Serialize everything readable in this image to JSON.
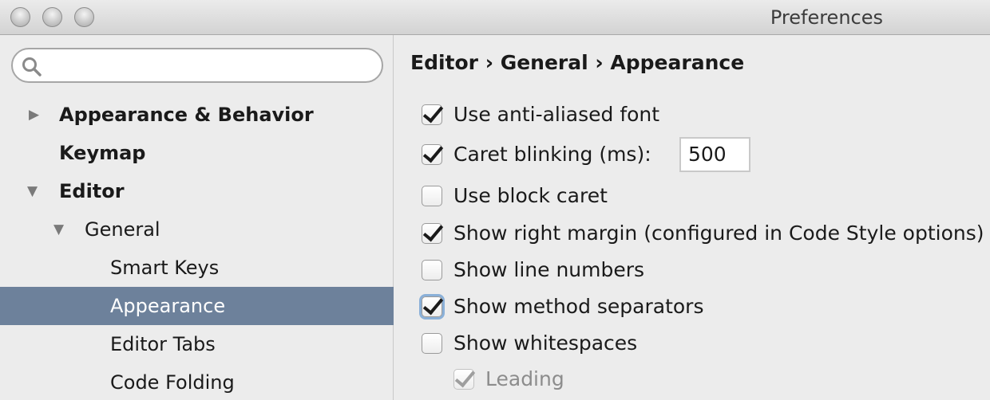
{
  "window": {
    "title": "Preferences"
  },
  "search": {
    "placeholder": "",
    "value": ""
  },
  "sidebar": {
    "items": [
      {
        "label": "Appearance & Behavior",
        "arrow": "▶"
      },
      {
        "label": "Keymap"
      },
      {
        "label": "Editor",
        "arrow": "▼"
      },
      {
        "label": "General",
        "arrow": "▼"
      },
      {
        "label": "Smart Keys"
      },
      {
        "label": "Appearance"
      },
      {
        "label": "Editor Tabs"
      },
      {
        "label": "Code Folding"
      }
    ],
    "selected": "Appearance"
  },
  "main": {
    "breadcrumb": "Editor › General › Appearance",
    "caret_blink_value": "500",
    "options": [
      {
        "label": "Use anti-aliased font",
        "checked": true
      },
      {
        "label": "Caret blinking (ms):",
        "checked": true
      },
      {
        "label": "Use block caret",
        "checked": false
      },
      {
        "label": "Show right margin (configured in Code Style options)",
        "checked": true
      },
      {
        "label": "Show line numbers",
        "checked": false
      },
      {
        "label": "Show method separators",
        "checked": true
      },
      {
        "label": "Show whitespaces",
        "checked": false
      },
      {
        "label": "Leading",
        "checked": true,
        "disabled": true
      }
    ]
  },
  "colors": {
    "selection": "#6d819b",
    "focus_ring": "#8ab0d8"
  }
}
